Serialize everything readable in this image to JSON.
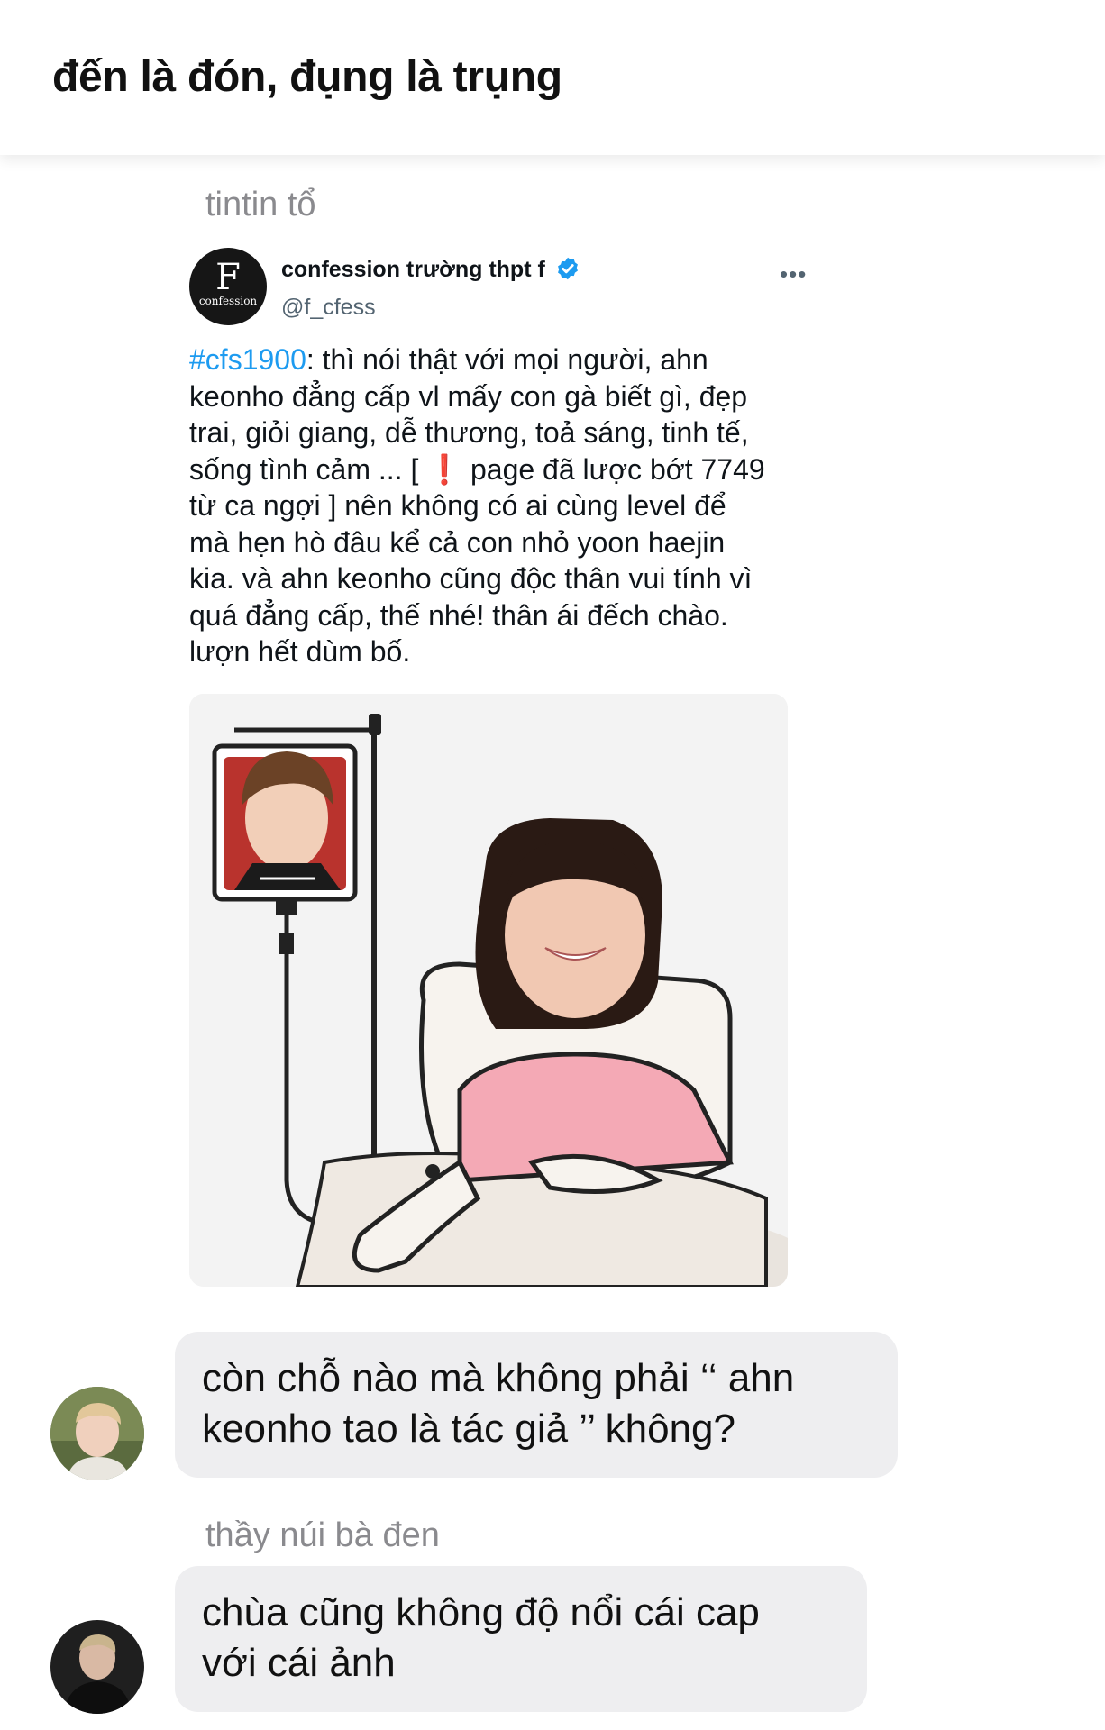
{
  "header": {
    "title": "đến là đón, đụng là trụng"
  },
  "messages": [
    {
      "sender": "tintin tổ",
      "tweet": {
        "avatar_text_big": "F",
        "avatar_text_small": "confession",
        "account_name": "confession trường thpt f",
        "verified_icon": "verified-badge-icon",
        "handle": "@f_cfess",
        "more_icon": "more-dots-icon",
        "more_glyph": "•••",
        "hashtag": "#cfs1900",
        "lines": [
          ": thì nói thật với mọi người, ahn",
          "keonho đẳng cấp vl mấy con gà biết gì, đẹp",
          "trai, giỏi giang, dễ thương, toả sáng, tinh tế,",
          "sống tình cảm ... [ ❗ page đã lược bớt 7749",
          "từ ca ngợi ] nên không có ai cùng level để",
          "mà hẹn hò đâu kể cả con nhỏ yoon haejin",
          "kia. và ahn keonho cũng độc thân vui tính vì",
          "quá đẳng cấp, thế nhé! thân ái đếch chào.",
          "lượn hết dùm bố."
        ],
        "image": "hospital-bed-iv-drip-illustration"
      }
    },
    {
      "sender": "",
      "text_lines": [
        "còn chỗ nào mà không phải ‘‘ ahn",
        "keonho tao là tác giả ’’ không?"
      ]
    },
    {
      "sender": "thầy núi bà đen",
      "text_lines": [
        "chùa cũng không độ nổi cái cap",
        "với cái ảnh"
      ]
    }
  ],
  "colors": {
    "bubble": "#eeeef0",
    "hashtag": "#1d9bf0",
    "verified": "#1d9bf0",
    "sender": "#8a8a8e"
  }
}
